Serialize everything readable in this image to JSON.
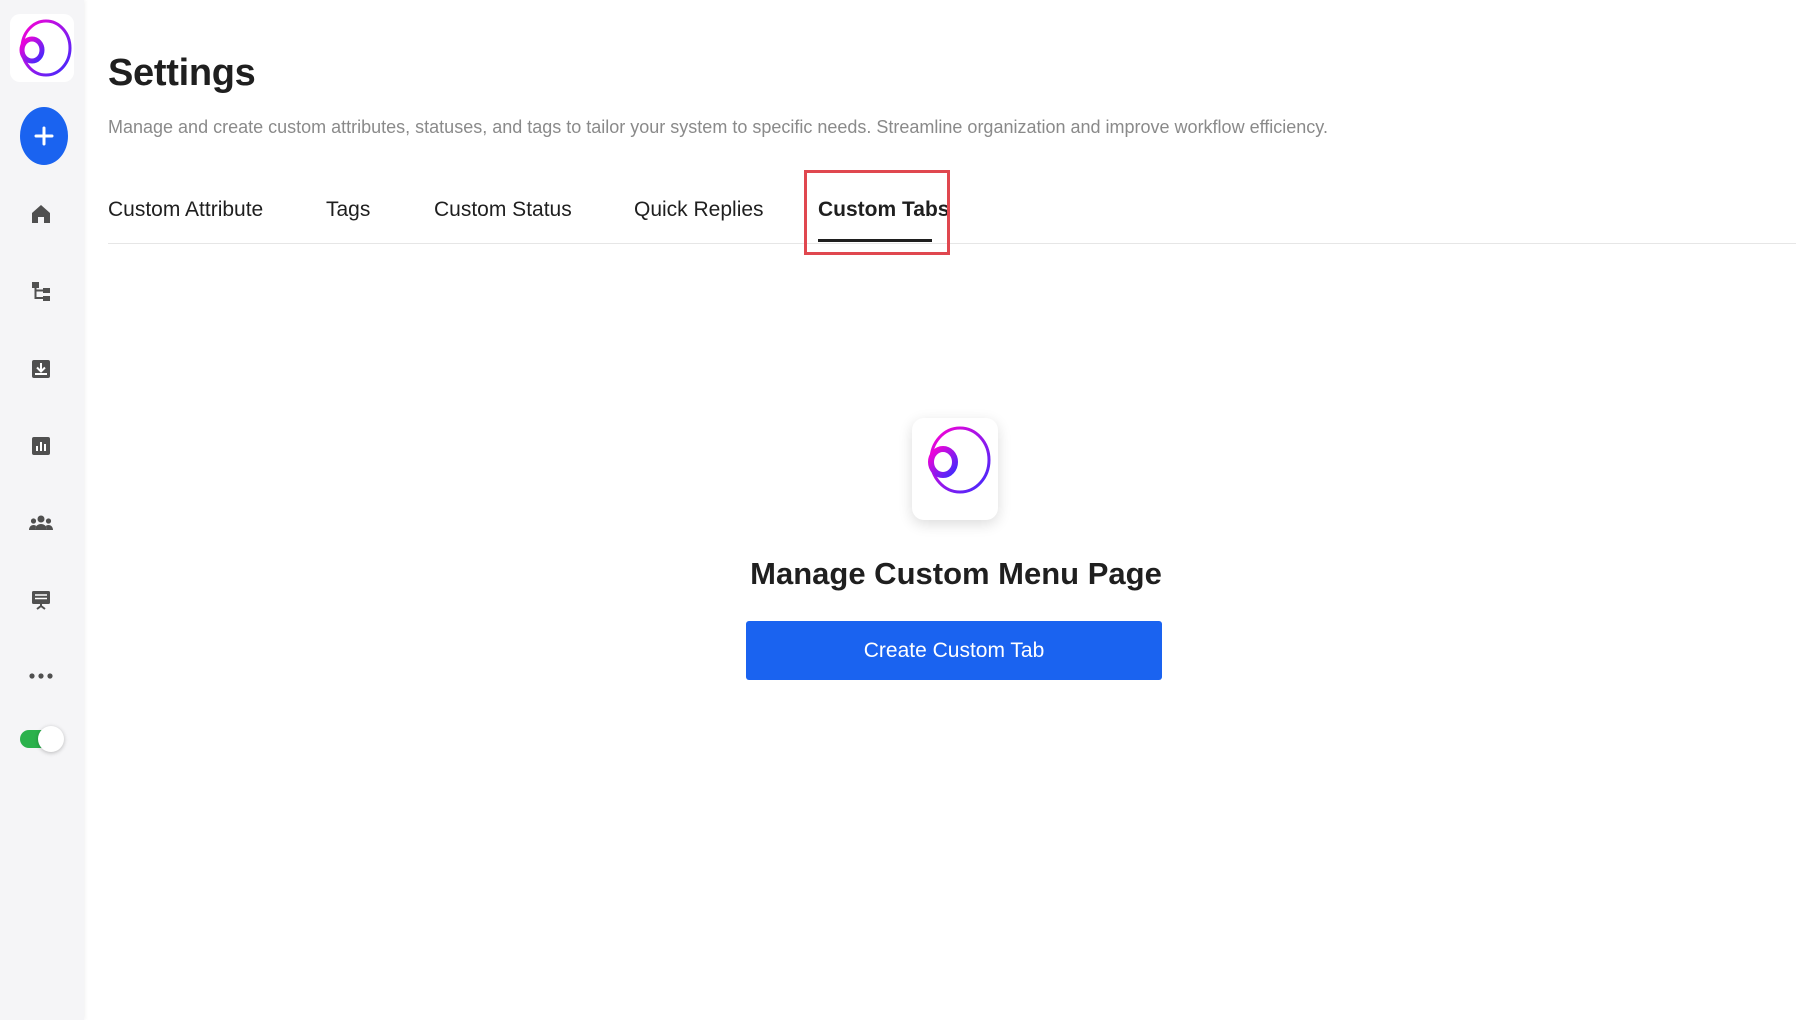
{
  "page": {
    "title": "Settings",
    "subtitle": "Manage and create custom attributes, statuses, and tags to tailor your system to specific needs. Streamline organization and improve workflow efficiency."
  },
  "tabs": [
    {
      "label": "Custom Attribute",
      "active": false
    },
    {
      "label": "Tags",
      "active": false
    },
    {
      "label": "Custom Status",
      "active": false
    },
    {
      "label": "Quick Replies",
      "active": false
    },
    {
      "label": "Custom Tabs",
      "active": true
    }
  ],
  "sidebar": {
    "items": [
      {
        "icon": "home-icon"
      },
      {
        "icon": "workflow-icon"
      },
      {
        "icon": "inbox-download-icon"
      },
      {
        "icon": "analytics-icon"
      },
      {
        "icon": "contacts-group-icon"
      },
      {
        "icon": "broadcast-icon"
      },
      {
        "icon": "more-icon"
      }
    ],
    "toggle_on": true
  },
  "empty_state": {
    "heading": "Manage Custom Menu Page",
    "button_label": "Create Custom Tab"
  },
  "colors": {
    "accent": "#1a63f0",
    "highlight": "#e0474f",
    "toggle": "#2bb24c",
    "logo_gradient_start": "#ff00d4",
    "logo_gradient_end": "#3a2bff"
  }
}
